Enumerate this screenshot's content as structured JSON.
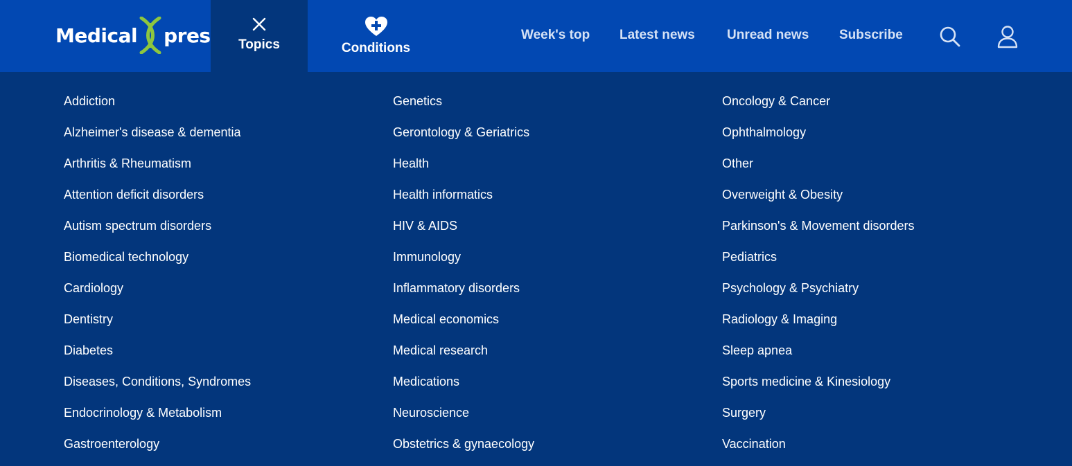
{
  "header": {
    "logo": {
      "left": "Medical",
      "right": "press"
    },
    "topics_tab": {
      "label": "Topics",
      "icon": "close-icon"
    },
    "conditions_tab": {
      "label": "Conditions",
      "icon": "heart-plus-icon"
    },
    "nav": [
      "Week's top",
      "Latest news",
      "Unread news",
      "Subscribe"
    ],
    "search_icon": "search-icon",
    "user_icon": "user-icon"
  },
  "colors": {
    "header_bg": "#0248b2",
    "menu_bg": "#03367c",
    "dna_green": "#8dc63f",
    "text": "#ffffff"
  },
  "topics": {
    "col1": [
      "Addiction",
      "Alzheimer's disease & dementia",
      "Arthritis & Rheumatism",
      "Attention deficit disorders",
      "Autism spectrum disorders",
      "Biomedical technology",
      "Cardiology",
      "Dentistry",
      "Diabetes",
      "Diseases, Conditions, Syndromes",
      "Endocrinology & Metabolism",
      "Gastroenterology"
    ],
    "col2": [
      "Genetics",
      "Gerontology & Geriatrics",
      "Health",
      "Health informatics",
      "HIV & AIDS",
      "Immunology",
      "Inflammatory disorders",
      "Medical economics",
      "Medical research",
      "Medications",
      "Neuroscience",
      "Obstetrics & gynaecology"
    ],
    "col3": [
      "Oncology & Cancer",
      "Ophthalmology",
      "Other",
      "Overweight & Obesity",
      "Parkinson's & Movement disorders",
      "Pediatrics",
      "Psychology & Psychiatry",
      "Radiology & Imaging",
      "Sleep apnea",
      "Sports medicine & Kinesiology",
      "Surgery",
      "Vaccination"
    ]
  }
}
